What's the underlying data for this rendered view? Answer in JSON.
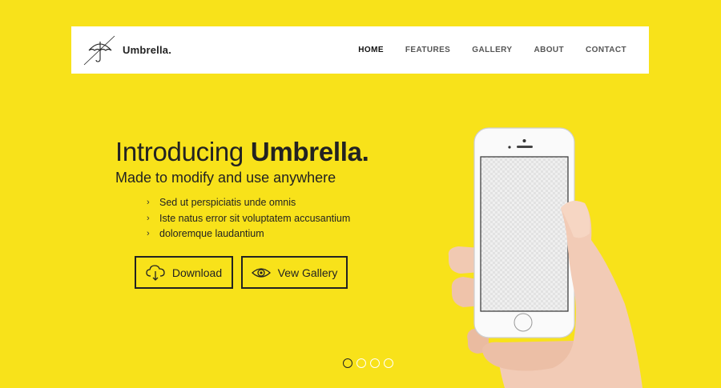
{
  "brand": {
    "name": "Umbrella.",
    "logo_icon": "umbrella-icon"
  },
  "nav": {
    "items": [
      {
        "label": "HOME",
        "active": true
      },
      {
        "label": "FEATURES",
        "active": false
      },
      {
        "label": "GALLERY",
        "active": false
      },
      {
        "label": "ABOUT",
        "active": false
      },
      {
        "label": "CONTACT",
        "active": false
      }
    ]
  },
  "hero": {
    "title_prefix": "Introducing",
    "title_strong": "Umbrella.",
    "subtitle": "Made to modify and use anywhere",
    "features": [
      "Sed ut perspiciatis unde omnis",
      "Iste natus error sit voluptatem accusantium",
      "doloremque laudantium"
    ]
  },
  "buttons": {
    "download": {
      "label": "Download",
      "icon": "cloud-download-icon"
    },
    "gallery": {
      "label": "Vew Gallery",
      "icon": "eye-icon"
    }
  },
  "slider": {
    "count": 4,
    "active_index": 0
  },
  "colors": {
    "background": "#f8e21a",
    "text": "#222222",
    "nav_bg": "#ffffff"
  }
}
